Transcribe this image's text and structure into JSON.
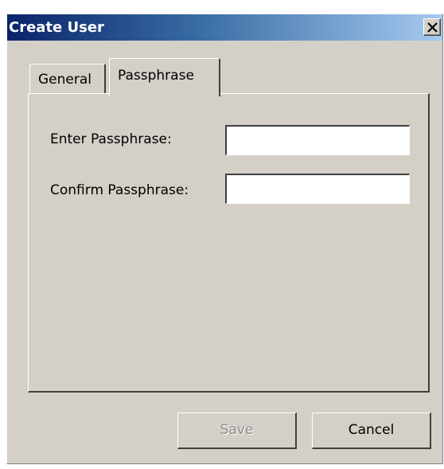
{
  "window": {
    "title": "Create User"
  },
  "titlebar": {
    "close_icon": "close-icon"
  },
  "tabs": [
    {
      "label": "General",
      "selected": false
    },
    {
      "label": "Passphrase",
      "selected": true
    }
  ],
  "form": {
    "enter_label": "Enter Passphrase:",
    "enter_value": "",
    "confirm_label": "Confirm Passphrase:",
    "confirm_value": ""
  },
  "buttons": {
    "save_label": "Save",
    "save_enabled": false,
    "cancel_label": "Cancel"
  },
  "colors": {
    "titlebar_start": "#0a246a",
    "titlebar_end": "#a6caf0",
    "window_face": "#d4d0c8",
    "disabled_text": "#8c8c8c"
  }
}
